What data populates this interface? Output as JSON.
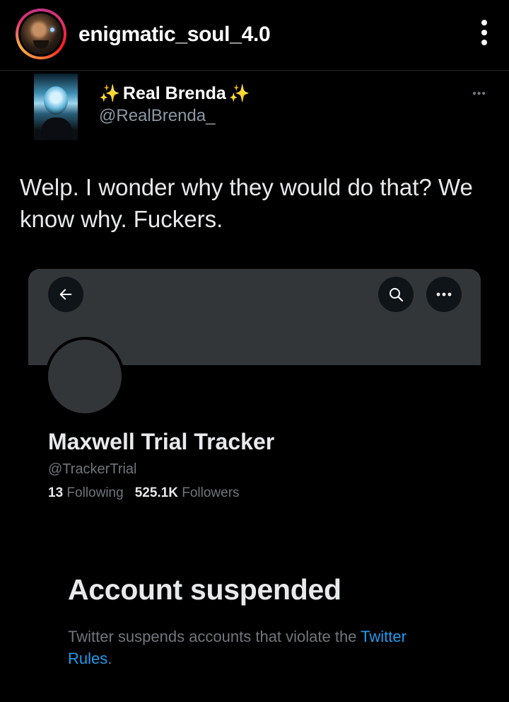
{
  "instagram": {
    "username": "enigmatic_soul_4.0",
    "avatar_icon": "profile-photo",
    "more_icon": "vertical-ellipsis-icon"
  },
  "tweet": {
    "display_name": "Real Brenda",
    "name_decoration": "✨",
    "handle": "@RealBrenda_",
    "more_label": "•••",
    "text": "Welp. I wonder why they would do that? We know why. Fuckers."
  },
  "embedded_profile": {
    "name": "Maxwell Trial Tracker",
    "handle": "@TrackerTrial",
    "following_count": "13",
    "following_label": "Following",
    "followers_count": "525.1K",
    "followers_label": "Followers",
    "more_label": "•••",
    "icons": {
      "back": "back-arrow-icon",
      "search": "search-icon",
      "more": "horizontal-ellipsis-icon"
    }
  },
  "suspension": {
    "title": "Account suspended",
    "body": "Twitter suspends accounts that violate the ",
    "link": "Twitter Rules",
    "suffix": "."
  },
  "colors": {
    "background": "#000000",
    "banner": "#333639",
    "secondary_text": "#71767b",
    "link": "#1d9bf0",
    "sparkle": "#f3c64c"
  }
}
